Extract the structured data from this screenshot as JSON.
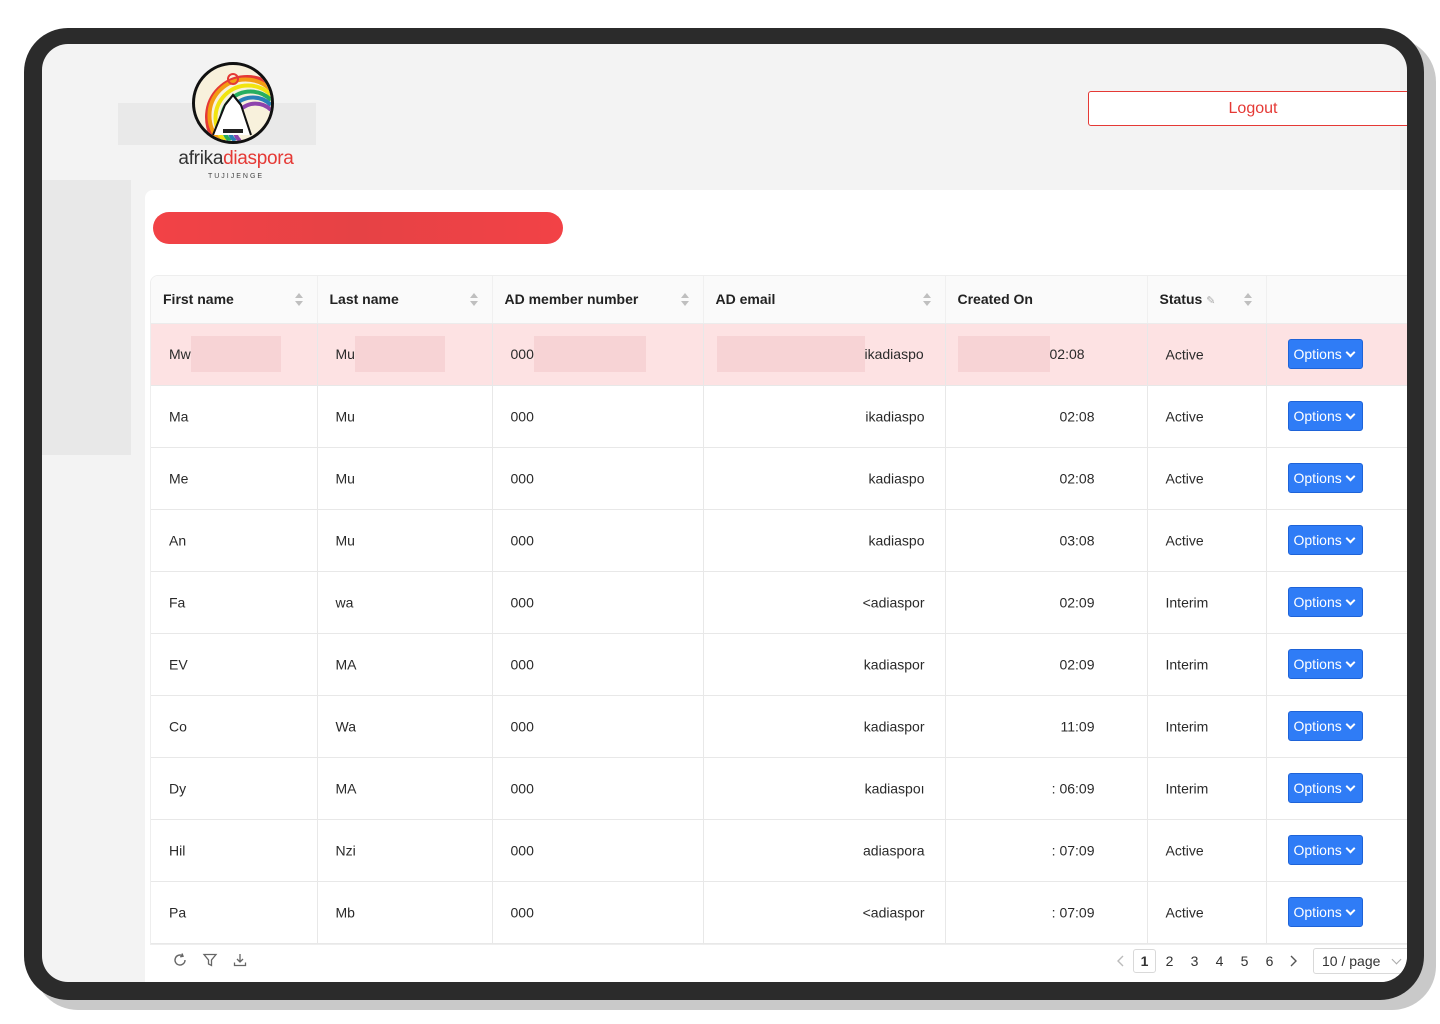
{
  "header": {
    "logo_word1": "afrika",
    "logo_word2": "diaspora",
    "logo_sub": "TUJIJENGE",
    "logout_label": "Logout"
  },
  "table": {
    "columns": [
      "First name",
      "Last name",
      "AD member number",
      "AD email",
      "Created On",
      "Status",
      ""
    ],
    "rows": [
      {
        "first": "Mw",
        "last": "Mu",
        "member": "000",
        "email": "ikadiaspo",
        "created": "02:08",
        "status": "Active"
      },
      {
        "first": "Ma",
        "last": "Mu",
        "member": "000",
        "email": "ikadiaspo",
        "created": "02:08",
        "status": "Active"
      },
      {
        "first": "Me",
        "last": "Mu",
        "member": "000",
        "email": "kadiaspo",
        "created": "02:08",
        "status": "Active"
      },
      {
        "first": "An",
        "last": "Mu",
        "member": "000",
        "email": "kadiaspo",
        "created": "03:08",
        "status": "Active"
      },
      {
        "first": "Fa",
        "last": "wa",
        "member": "000",
        "email": "<adiaspor",
        "created": "02:09",
        "status": "Interim"
      },
      {
        "first": "EV",
        "last": "MA",
        "member": "000",
        "email": "kadiaspor",
        "created": "02:09",
        "status": "Interim"
      },
      {
        "first": "Co",
        "last": "Wa",
        "member": "000",
        "email": "kadiaspor",
        "created": "11:09",
        "status": "Interim"
      },
      {
        "first": "Dy",
        "last": "MA",
        "member": "000",
        "email": "kadiaspoı",
        "created": ": 06:09",
        "status": "Interim"
      },
      {
        "first": "Hil",
        "last": "Nzi",
        "member": "000",
        "email": "adiaspora",
        "created": ": 07:09",
        "status": "Active"
      },
      {
        "first": "Pa",
        "last": "Mb",
        "member": "000",
        "email": "<adiaspor",
        "created": ": 07:09",
        "status": "Active"
      }
    ],
    "options_label": "Options"
  },
  "pagination": {
    "pages": [
      "1",
      "2",
      "3",
      "4",
      "5",
      "6"
    ],
    "current": "1",
    "page_size": "10 / page"
  },
  "icons": [
    "reload-icon",
    "filter-icon",
    "download-icon",
    "chevron-left-icon",
    "chevron-right-icon",
    "chevron-down-icon",
    "edit-icon",
    "sort-icon"
  ],
  "colors": {
    "accent": "#e53935",
    "primary": "#2f7cf6",
    "highlight": "#fde2e3"
  }
}
